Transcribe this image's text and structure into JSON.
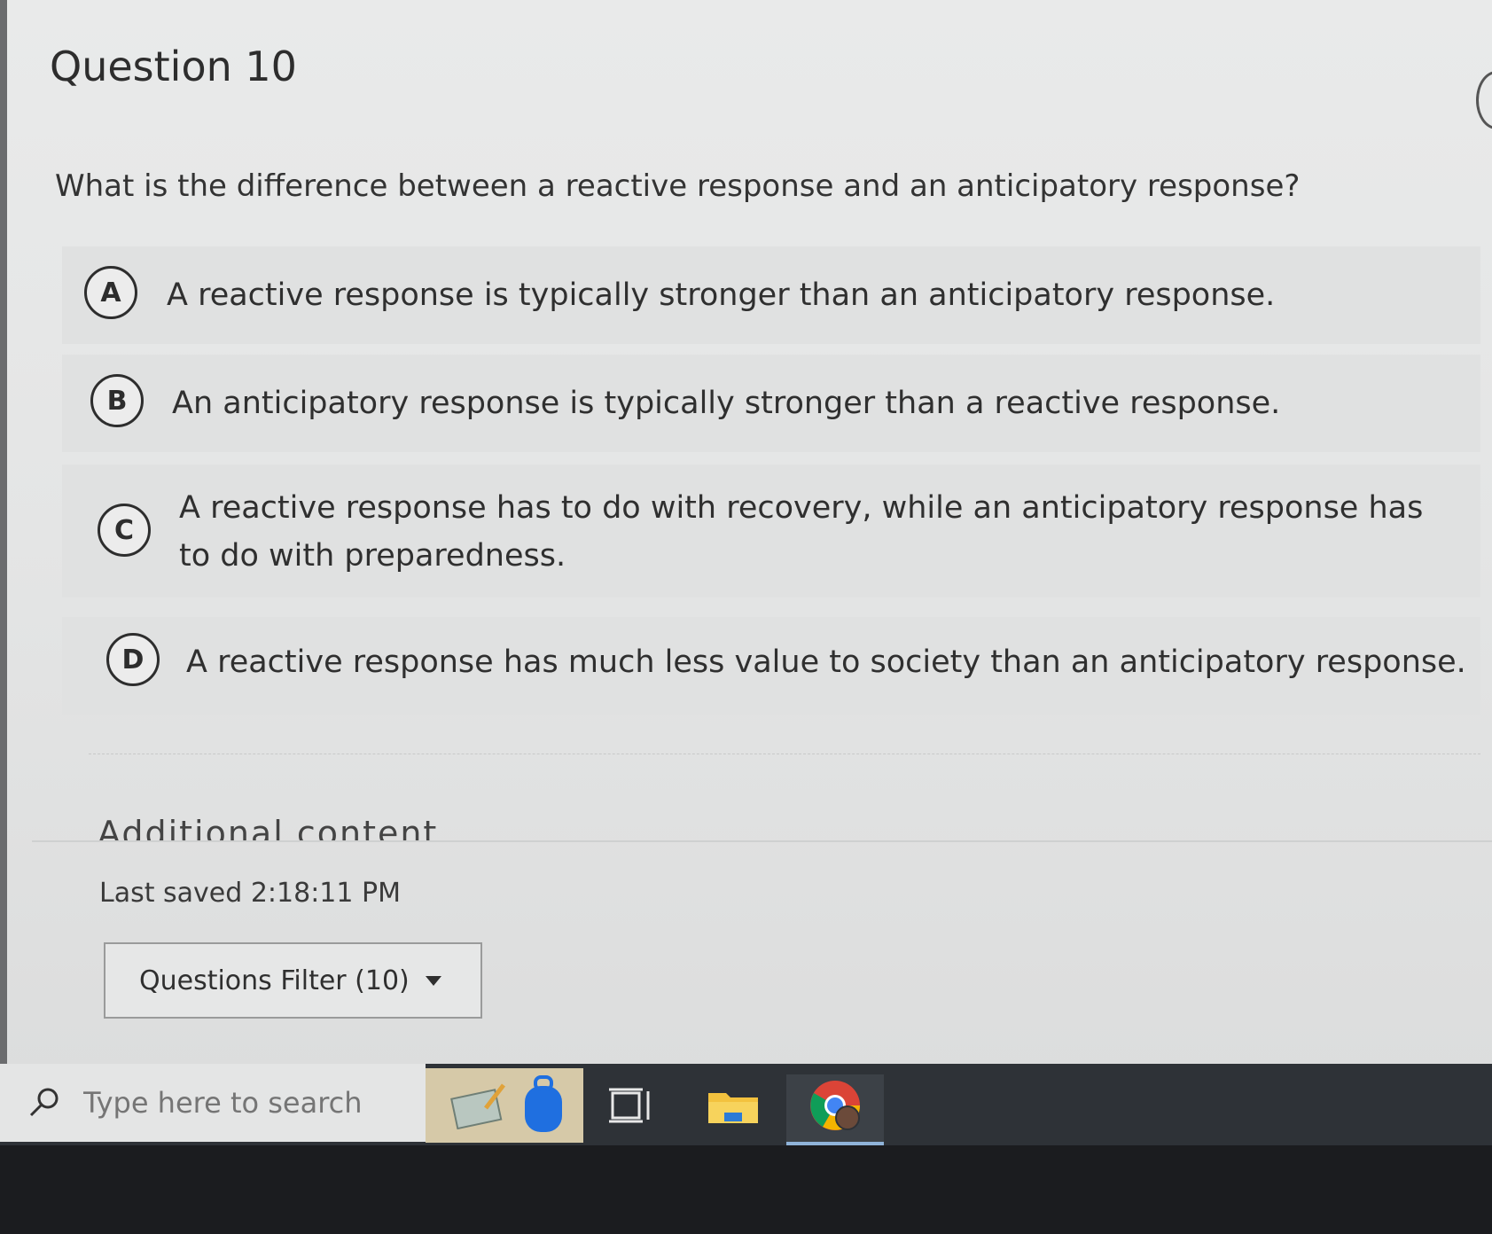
{
  "question": {
    "title": "Question 10",
    "text": "What is the difference between a reactive response and an anticipatory response?",
    "options": [
      {
        "letter": "A",
        "text": "A reactive response is typically stronger than an anticipatory response."
      },
      {
        "letter": "B",
        "text": "An anticipatory response is typically stronger than a reactive response."
      },
      {
        "letter": "C",
        "text": "A reactive response has to do with recovery, while an anticipatory response has to do with preparedness."
      },
      {
        "letter": "D",
        "text": "A reactive response has much less value to society than an anticipatory response."
      }
    ]
  },
  "footer": {
    "additional_content": "Additional content",
    "last_saved": "Last saved 2:18:11 PM",
    "filter_label": "Questions Filter (10)"
  },
  "taskbar": {
    "search_placeholder": "Type here to search",
    "icons": [
      "search-icon",
      "notebook-app-icon",
      "backpack-app-icon",
      "task-view-icon",
      "file-explorer-icon",
      "chrome-icon"
    ]
  },
  "colors": {
    "screen_bg": "#e4e5e5",
    "taskbar_bg": "#2e3237",
    "text": "#2f2f2f",
    "chrome_active_underline": "#8fb3d9"
  }
}
